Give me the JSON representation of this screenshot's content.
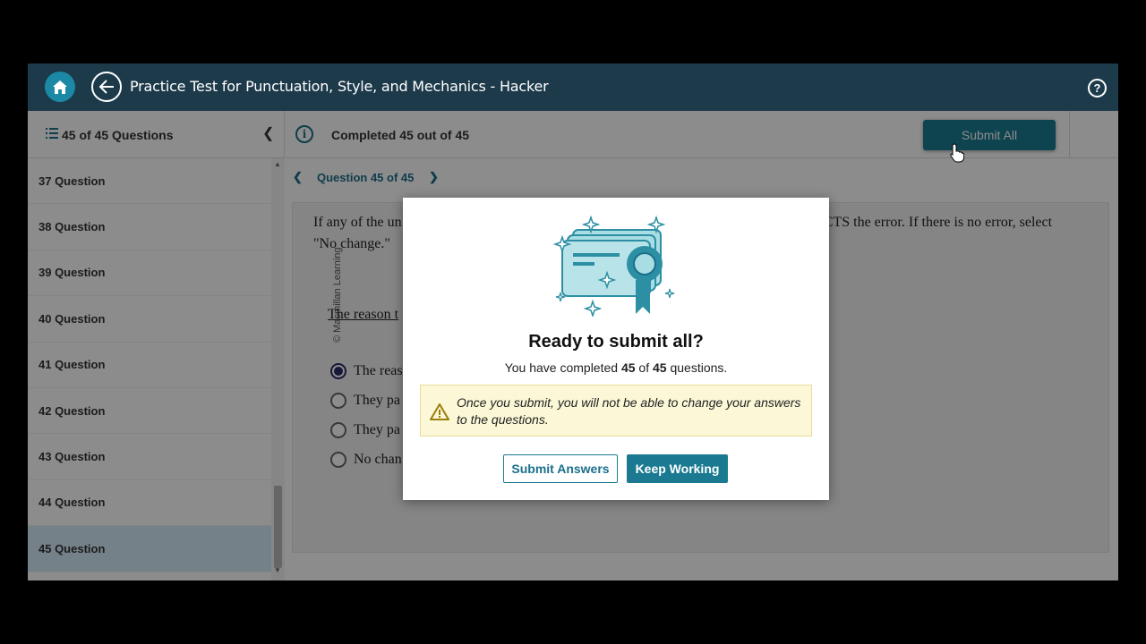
{
  "header": {
    "title": "Practice Test for Punctuation, Style, and Mechanics - Hacker",
    "help_label": "?"
  },
  "sidebar": {
    "title": "45 of 45 Questions",
    "items": [
      {
        "label": "37 Question"
      },
      {
        "label": "38 Question"
      },
      {
        "label": "39 Question"
      },
      {
        "label": "40 Question"
      },
      {
        "label": "41 Question"
      },
      {
        "label": "42 Question"
      },
      {
        "label": "43 Question"
      },
      {
        "label": "44 Question"
      },
      {
        "label": "45 Question"
      }
    ],
    "float_help": "?"
  },
  "main": {
    "info_icon": "i",
    "completed_text": "Completed 45 out of 45",
    "submit_all_label": "Submit All",
    "question_nav_label": "Question 45 of 45",
    "watermark": "© Macmillan Learning",
    "question_text_left": "If any of the un",
    "question_text_right": "ECTS the error. If there is no error, select",
    "question_text_line2": "\"No change.\"",
    "sentence": "The reason t",
    "options": [
      {
        "label": "The reas",
        "selected": true
      },
      {
        "label": "They pa",
        "selected": false
      },
      {
        "label": "They pa",
        "selected": false
      },
      {
        "label": "No chan",
        "selected": false
      }
    ]
  },
  "modal": {
    "title": "Ready to submit all?",
    "sub_prefix": "You have completed ",
    "sub_completed": "45",
    "sub_of": " of ",
    "sub_total": "45",
    "sub_suffix": " questions.",
    "warning": "Once you submit, you will not be able to change your answers to the questions.",
    "submit_answers_label": "Submit Answers",
    "keep_working_label": "Keep Working"
  },
  "colors": {
    "header_bg": "#1d3a4b",
    "accent": "#1b7a92",
    "warning_bg": "#fcf8d7"
  }
}
